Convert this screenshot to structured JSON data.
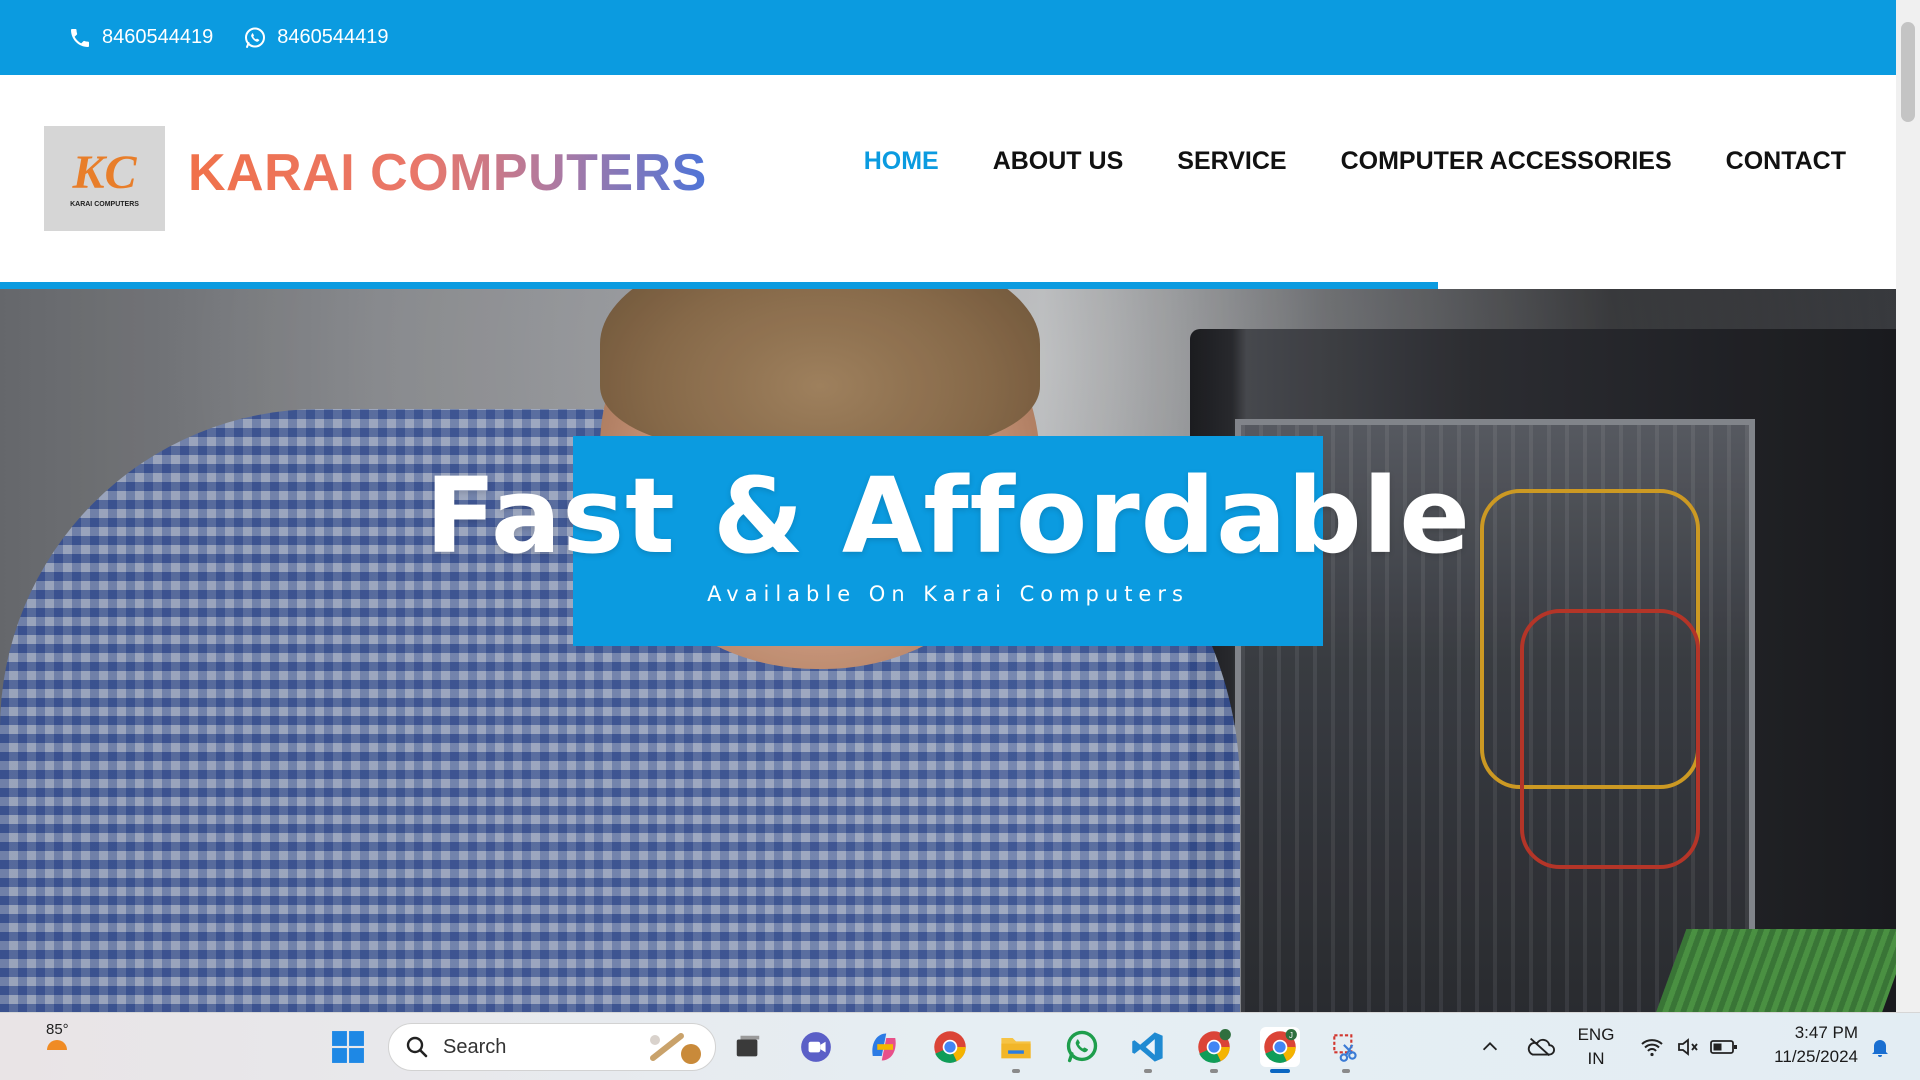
{
  "topbar": {
    "phone": "8460544419",
    "whatsapp": "8460544419",
    "phone_icon": "phone-icon",
    "whatsapp_icon": "whatsapp-icon"
  },
  "header": {
    "logo_mark": "KC",
    "logo_sub": "KARAI COMPUTERS",
    "brand_title": "KARAI COMPUTERS",
    "nav": [
      {
        "label": "HOME",
        "active": true
      },
      {
        "label": "ABOUT US",
        "active": false
      },
      {
        "label": "SERVICE",
        "active": false
      },
      {
        "label": "COMPUTER ACCESSORIES",
        "active": false
      },
      {
        "label": "CONTACT",
        "active": false
      }
    ]
  },
  "hero": {
    "title": "Fast & Affordable",
    "subtitle": "Available On Karai Computers"
  },
  "taskbar": {
    "weather_temp": "85°",
    "search_placeholder": "Search",
    "language_line1": "ENG",
    "language_line2": "IN",
    "time": "3:47 PM",
    "date": "11/25/2024",
    "apps": [
      "windows-start-icon",
      "search-icon",
      "task-view-icon",
      "meet-icon",
      "copilot-icon",
      "chrome-icon",
      "file-explorer-icon",
      "whatsapp-icon",
      "vscode-icon",
      "chrome-profile-icon",
      "chrome-profile-j-icon",
      "snipping-tool-icon"
    ]
  },
  "colors": {
    "accent": "#0b9be0",
    "nav_text": "#111111",
    "brand_gradient_start": "#f0714a",
    "brand_gradient_end": "#4e74d8"
  }
}
